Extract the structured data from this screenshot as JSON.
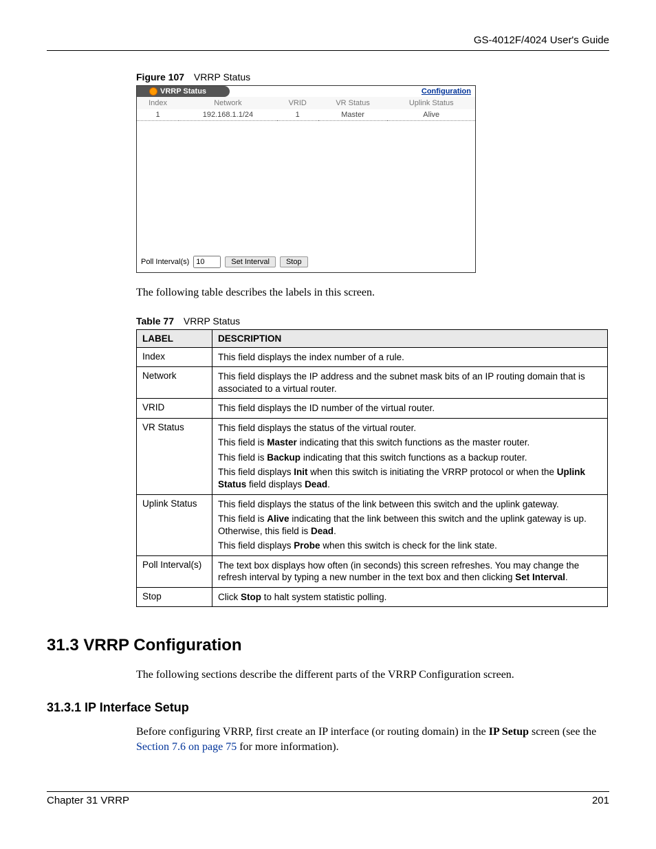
{
  "header": {
    "guide": "GS-4012F/4024 User's Guide"
  },
  "figure": {
    "num": "Figure 107",
    "title": "VRRP Status",
    "tab_label": "VRRP Status",
    "config_link": "Configuration",
    "columns": {
      "c1": "Index",
      "c2": "Network",
      "c3": "VRID",
      "c4": "VR Status",
      "c5": "Uplink Status"
    },
    "row": {
      "index": "1",
      "network": "192.168.1.1/24",
      "vrid": "1",
      "vr": "Master",
      "uplink": "Alive"
    },
    "poll_label": "Poll Interval(s)",
    "poll_value": "10",
    "btn_set": "Set Interval",
    "btn_stop": "Stop"
  },
  "intro_text": "The following table describes the labels in this screen.",
  "table_caption": {
    "num": "Table 77",
    "title": "VRRP Status"
  },
  "desc": {
    "h_label": "LABEL",
    "h_desc": "DESCRIPTION",
    "rows": {
      "index": {
        "l": "Index",
        "d1": "This field displays the index number of a rule."
      },
      "network": {
        "l": "Network",
        "d1": "This field displays the IP address and the subnet mask bits of an IP routing domain that is associated to a virtual router."
      },
      "vrid": {
        "l": "VRID",
        "d1": "This field displays the ID number of the virtual router."
      },
      "vrstatus": {
        "l": "VR Status",
        "d1": "This field displays the status of the virtual router.",
        "d2a": "This field is ",
        "d2b": "Master",
        "d2c": " indicating that this switch functions as the master router.",
        "d3a": "This field is ",
        "d3b": "Backup",
        "d3c": " indicating that this switch functions as a backup router.",
        "d4a": "This field displays ",
        "d4b": "Init",
        "d4c": " when this switch is initiating the VRRP protocol or when the ",
        "d4d": "Uplink Status",
        "d4e": " field displays ",
        "d4f": "Dead",
        "d4g": "."
      },
      "uplink": {
        "l": "Uplink Status",
        "d1": "This field displays the status of the link between this switch and the uplink gateway.",
        "d2a": "This field is ",
        "d2b": "Alive",
        "d2c": " indicating that the link between this switch and the uplink gateway is up. Otherwise, this field is ",
        "d2d": "Dead",
        "d2e": ".",
        "d3a": "This field displays ",
        "d3b": "Probe",
        "d3c": " when this switch is check for the link state."
      },
      "poll": {
        "l": "Poll Interval(s)",
        "d1a": "The text box displays how often (in seconds) this screen refreshes. You may change the refresh interval by typing a new number in the text box and then clicking ",
        "d1b": "Set Interval",
        "d1c": "."
      },
      "stop": {
        "l": "Stop",
        "d1a": "Click ",
        "d1b": "Stop",
        "d1c": " to halt system statistic polling."
      }
    }
  },
  "sec": {
    "h2": "31.3  VRRP Configuration",
    "p1": "The following sections describe the different parts of the VRRP Configuration screen.",
    "h3": "31.3.1  IP Interface Setup",
    "p2a": "Before configuring VRRP, first create an IP interface (or routing domain) in the ",
    "p2b": "IP Setup",
    "p2c": " screen (see the ",
    "p2d": "Section 7.6 on page 75",
    "p2e": " for more information)."
  },
  "footer": {
    "chapter": "Chapter 31 VRRP",
    "page": "201"
  }
}
